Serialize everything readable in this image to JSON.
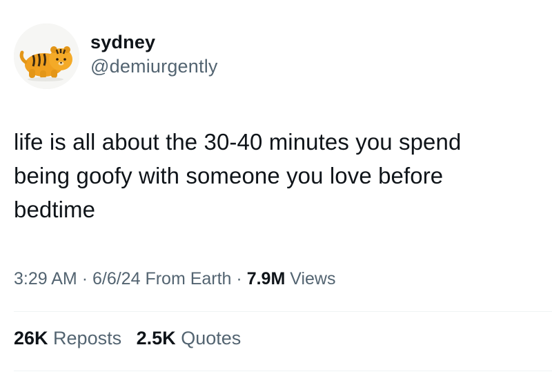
{
  "author": {
    "display_name": "sydney",
    "handle": "@demiurgently",
    "avatar": "tiger-plush-avatar"
  },
  "tweet": {
    "lines": [
      "life is all about the 30-40 minutes you spend",
      "being goofy with someone you love before",
      "bedtime"
    ]
  },
  "meta": {
    "time": "3:29 AM",
    "sep1": "·",
    "date": "6/6/24",
    "source": "From Earth",
    "sep2": "·",
    "views_count": "7.9M",
    "views_label": "Views"
  },
  "stats": {
    "reposts_count": "26K",
    "reposts_label": "Reposts",
    "quotes_count": "2.5K",
    "quotes_label": "Quotes"
  },
  "colors": {
    "text": "#0f1419",
    "secondary": "#536471",
    "divider": "#eff3f4"
  }
}
